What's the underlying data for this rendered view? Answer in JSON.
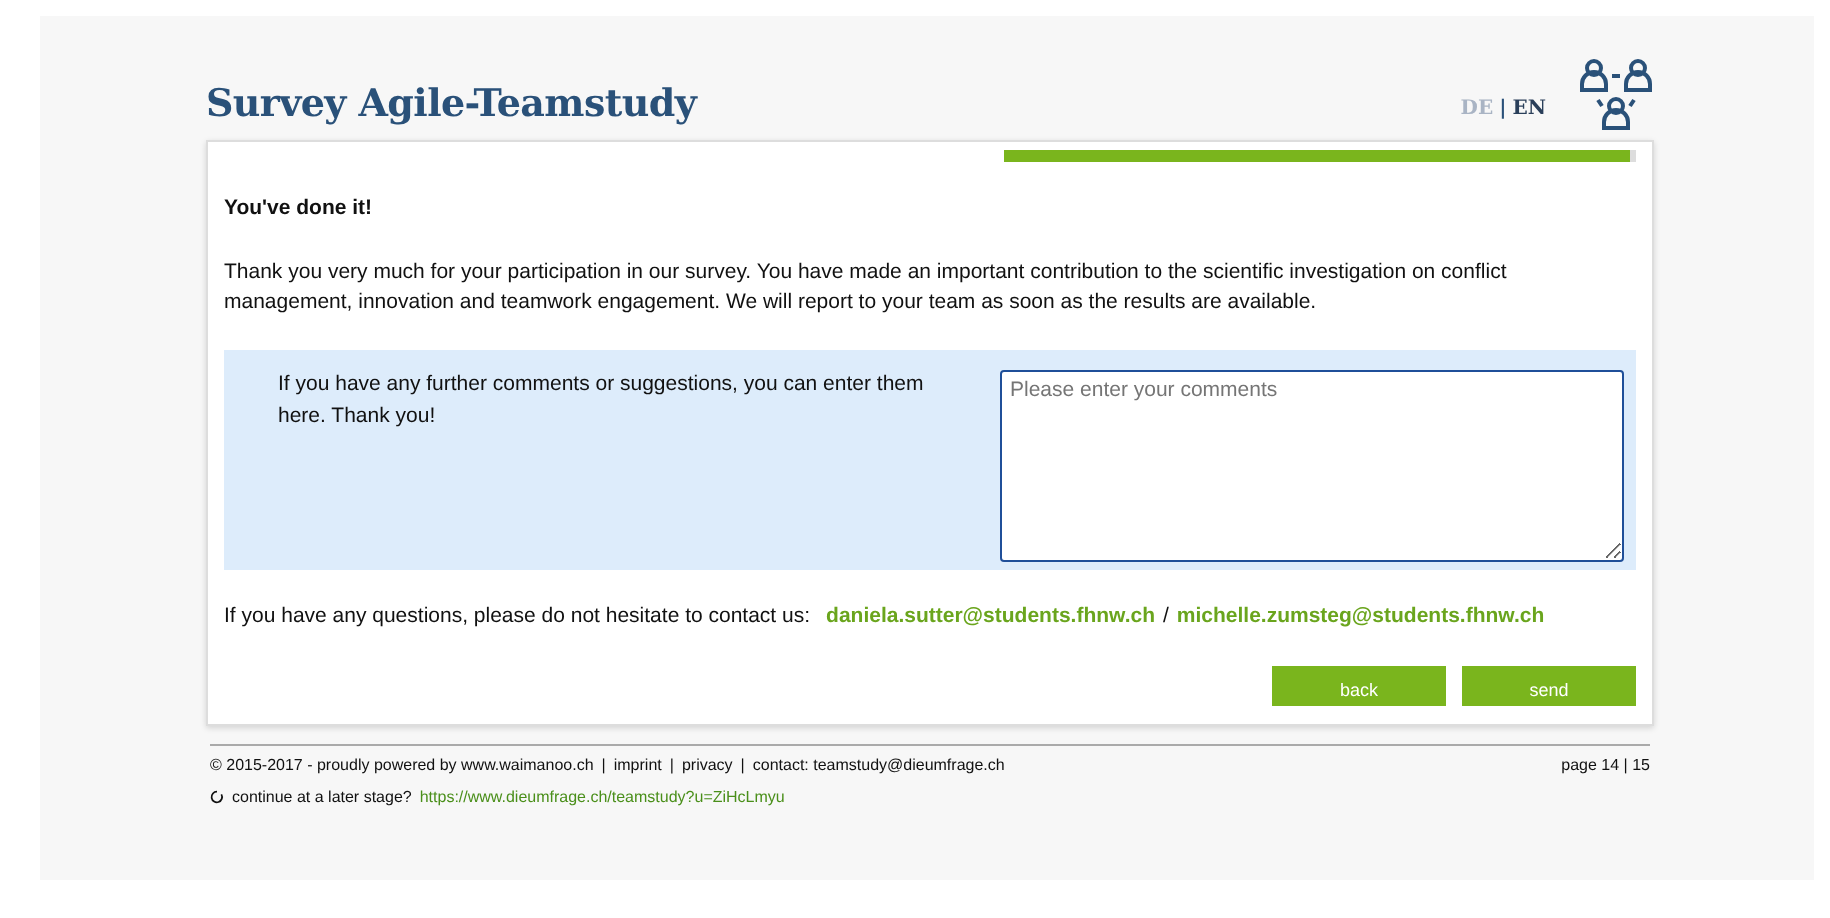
{
  "header": {
    "title": "Survey Agile-Teamstudy",
    "separator": "|",
    "languages": [
      {
        "label": "DE",
        "selected": false
      },
      {
        "label": "EN",
        "selected": true
      }
    ]
  },
  "progress": {
    "level": 0.99
  },
  "content": {
    "heading": "You've done it!",
    "message": "Thank you very much for your participation in our survey. You have made an important contribution to the scientific investigation on conflict management, innovation and teamwork engagement. We will report to your team as soon as the results are available.",
    "comment_prompt": "If you have any further comments or suggestions, you can enter them here. Thank you!",
    "comment_field": {
      "placeholder": "Please enter your comments"
    },
    "contact_text": "If you have any questions, please do not hesitate to contact us:",
    "contacts": [
      "daniela.sutter@students.fhnw.ch",
      "michelle.zumsteg@students.fhnw.ch"
    ],
    "separator": "/"
  },
  "buttons": [
    "back",
    "send"
  ],
  "footer": {
    "separator": "|",
    "copyright": "© 2015-2017 - proudly powered by www.waimanoo.ch",
    "links": [
      "imprint",
      "privacy"
    ],
    "contact": "contact: teamstudy@dieumfrage.ch",
    "page": "page 14 | 15",
    "resume_text": "continue at a later stage?",
    "resume_link": "https://www.dieumfrage.ch/teamstudy?u=ZiHcLmyu"
  }
}
